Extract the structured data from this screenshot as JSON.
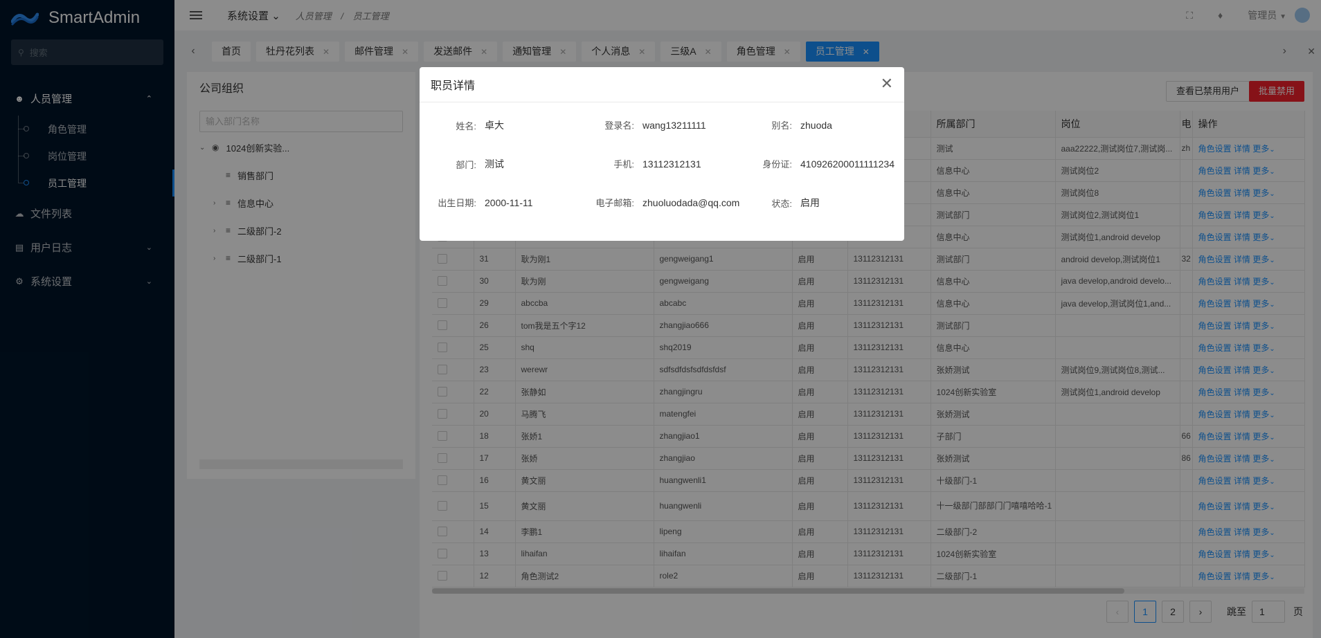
{
  "app": {
    "name": "SmartAdmin"
  },
  "sidebar": {
    "search_placeholder": "搜索",
    "menu": [
      {
        "label": "人员管理",
        "icon": "user-icon",
        "expanded": true,
        "children": [
          "角色管理",
          "岗位管理",
          "员工管理"
        ],
        "active_child": "员工管理"
      },
      {
        "label": "文件列表",
        "icon": "cloud-icon"
      },
      {
        "label": "用户日志",
        "icon": "book-icon"
      },
      {
        "label": "系统设置",
        "icon": "gear-icon"
      }
    ]
  },
  "header": {
    "system_menu": "系统设置",
    "breadcrumb": [
      "人员管理",
      "员工管理"
    ],
    "breadcrumb_sep": "/",
    "user": "管理员"
  },
  "tabs": [
    "首页",
    "牡丹花列表",
    "邮件管理",
    "发送邮件",
    "通知管理",
    "个人消息",
    "三级A",
    "角色管理",
    "员工管理"
  ],
  "active_tab": "员工管理",
  "org": {
    "title": "公司组织",
    "search_placeholder": "输入部门名称",
    "nodes": [
      {
        "label": "1024创新实验...",
        "level": 0
      },
      {
        "label": "销售部门",
        "level": 1
      },
      {
        "label": "信息中心",
        "level": 1
      },
      {
        "label": "二级部门-2",
        "level": 1
      },
      {
        "label": "二级部门-1",
        "level": 1
      }
    ]
  },
  "toolbar": {
    "view_disabled": "查看已禁用用户",
    "batch_disable": "批量禁用"
  },
  "table": {
    "columns": [
      "所属部门",
      "岗位",
      "电",
      "操作"
    ],
    "row_ops": [
      "角色设置",
      "详情",
      "更多"
    ],
    "rows": [
      {
        "id": "",
        "name": "",
        "login": "",
        "status": "",
        "phone": "",
        "dept": "测试",
        "post": "aaa22222,测试岗位7,测试岗...",
        "extra": "zh"
      },
      {
        "id": "",
        "name": "",
        "login": "",
        "status": "",
        "phone": "",
        "dept": "信息中心",
        "post": "测试岗位2",
        "extra": ""
      },
      {
        "id": "",
        "name": "",
        "login": "",
        "status": "",
        "phone": "",
        "dept": "信息中心",
        "post": "测试岗位8",
        "extra": ""
      },
      {
        "id": "",
        "name": "",
        "login": "",
        "status": "",
        "phone": "",
        "dept": "测试部门",
        "post": "测试岗位2,测试岗位1",
        "extra": ""
      },
      {
        "id": "",
        "name": "",
        "login": "",
        "status": "",
        "phone": "",
        "dept": "信息中心",
        "post": "测试岗位1,android develop",
        "extra": ""
      },
      {
        "id": "31",
        "name": "耿为刚1",
        "login": "gengweigang1",
        "status": "启用",
        "phone": "13112312131",
        "dept": "测试部门",
        "post": "android develop,测试岗位1",
        "extra": "32"
      },
      {
        "id": "30",
        "name": "耿为刚",
        "login": "gengweigang",
        "status": "启用",
        "phone": "13112312131",
        "dept": "信息中心",
        "post": "java develop,android develo...",
        "extra": ""
      },
      {
        "id": "29",
        "name": "abccba",
        "login": "abcabc",
        "status": "启用",
        "phone": "13112312131",
        "dept": "信息中心",
        "post": "java develop,测试岗位1,and...",
        "extra": ""
      },
      {
        "id": "26",
        "name": "tom我是五个字12",
        "login": "zhangjiao666",
        "status": "启用",
        "phone": "13112312131",
        "dept": "测试部门",
        "post": "",
        "extra": ""
      },
      {
        "id": "25",
        "name": "shq",
        "login": "shq2019",
        "status": "启用",
        "phone": "13112312131",
        "dept": "信息中心",
        "post": "",
        "extra": ""
      },
      {
        "id": "23",
        "name": "werewr",
        "login": "sdfsdfdsfsdfdsfdsf",
        "status": "启用",
        "phone": "13112312131",
        "dept": "张娇测试",
        "post": "测试岗位9,测试岗位8,测试...",
        "extra": ""
      },
      {
        "id": "22",
        "name": "张静如",
        "login": "zhangjingru",
        "status": "启用",
        "phone": "13112312131",
        "dept": "1024创新实验室",
        "post": "测试岗位1,android develop",
        "extra": ""
      },
      {
        "id": "20",
        "name": "马腾飞",
        "login": "matengfei",
        "status": "启用",
        "phone": "13112312131",
        "dept": "张娇测试",
        "post": "",
        "extra": ""
      },
      {
        "id": "18",
        "name": "张娇1",
        "login": "zhangjiao1",
        "status": "启用",
        "phone": "13112312131",
        "dept": "子部门",
        "post": "",
        "extra": "66"
      },
      {
        "id": "17",
        "name": "张娇",
        "login": "zhangjiao",
        "status": "启用",
        "phone": "13112312131",
        "dept": "张娇测试",
        "post": "",
        "extra": "86"
      },
      {
        "id": "16",
        "name": "黄文丽",
        "login": "huangwenli1",
        "status": "启用",
        "phone": "13112312131",
        "dept": "十级部门-1",
        "post": "",
        "extra": ""
      },
      {
        "id": "15",
        "name": "黄文丽",
        "login": "huangwenli",
        "status": "启用",
        "phone": "13112312131",
        "dept": "十一级部门部部门门嘻嘻哈哈-1",
        "post": "",
        "extra": ""
      },
      {
        "id": "14",
        "name": "李鹏1",
        "login": "lipeng",
        "status": "启用",
        "phone": "13112312131",
        "dept": "二级部门-2",
        "post": "",
        "extra": ""
      },
      {
        "id": "13",
        "name": "lihaifan",
        "login": "lihaifan",
        "status": "启用",
        "phone": "13112312131",
        "dept": "1024创新实验室",
        "post": "",
        "extra": ""
      },
      {
        "id": "12",
        "name": "角色测试2",
        "login": "role2",
        "status": "启用",
        "phone": "13112312131",
        "dept": "二级部门-1",
        "post": "",
        "extra": ""
      }
    ]
  },
  "pagination": {
    "pages": [
      "1",
      "2"
    ],
    "current": "1",
    "jump_label": "跳至",
    "jump_value": "1",
    "page_suffix": "页"
  },
  "modal": {
    "title": "职员详情",
    "fields": [
      {
        "label": "姓名:",
        "value": "卓大"
      },
      {
        "label": "登录名:",
        "value": "wang13211111"
      },
      {
        "label": "别名:",
        "value": "zhuoda"
      },
      {
        "label": "部门:",
        "value": "测试"
      },
      {
        "label": "手机:",
        "value": "13112312131"
      },
      {
        "label": "身份证:",
        "value": "410926200011111234"
      },
      {
        "label": "出生日期:",
        "value": "2000-11-11"
      },
      {
        "label": "电子邮箱:",
        "value": "zhuoluodada@qq.com"
      },
      {
        "label": "状态:",
        "value": "启用"
      }
    ]
  },
  "colors": {
    "sidebar_bg": "#001529",
    "primary": "#1890ff",
    "danger": "#f5222d"
  }
}
